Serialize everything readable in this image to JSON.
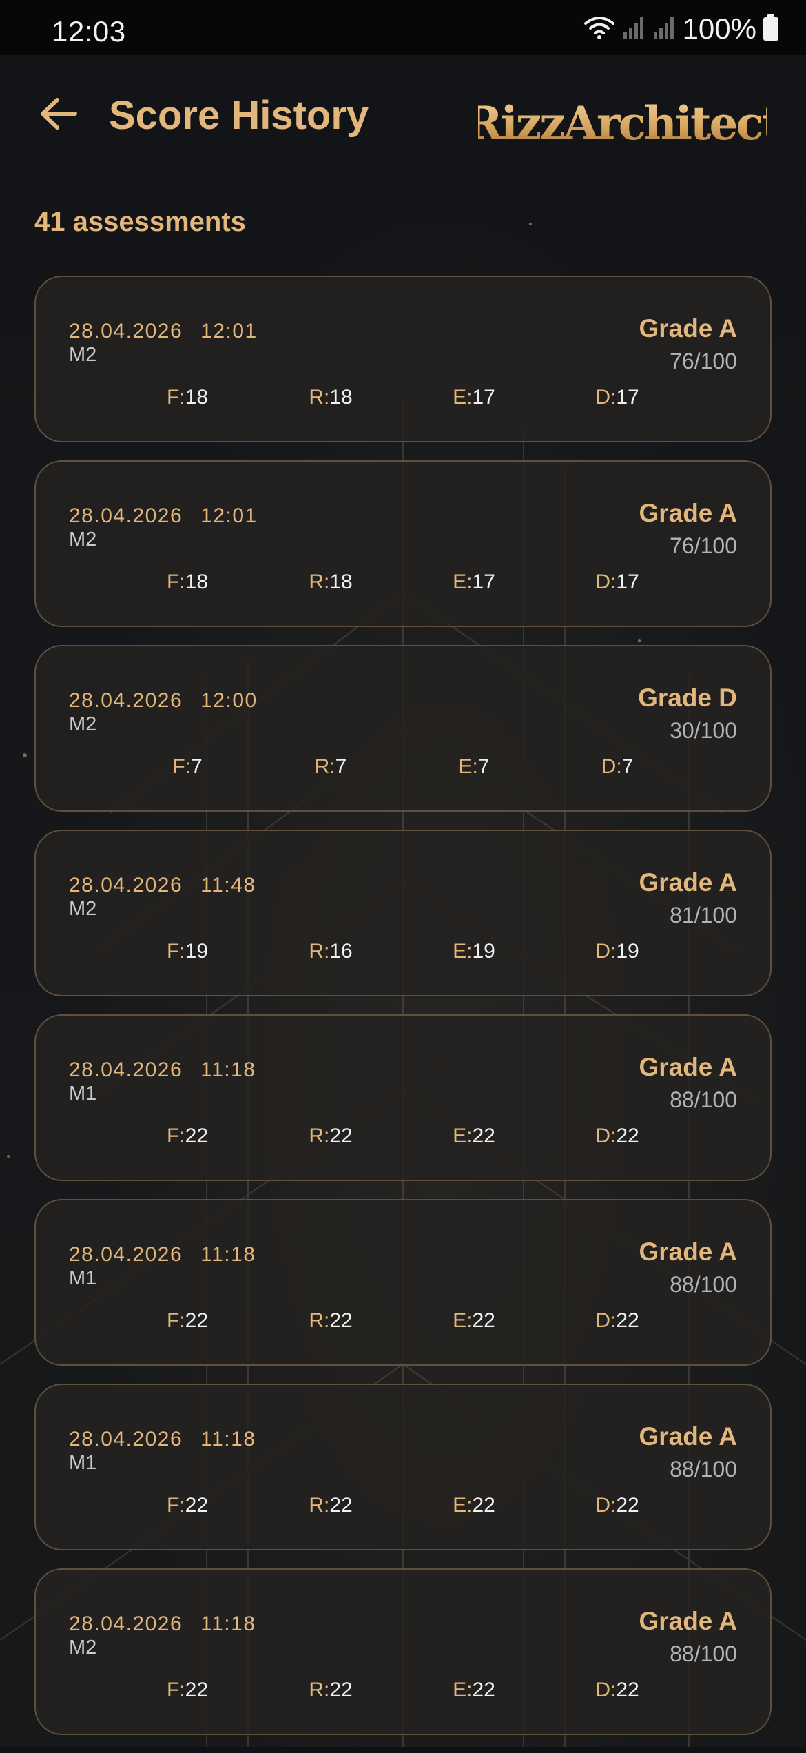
{
  "status_bar": {
    "time": "12:03",
    "battery_percent": "100%"
  },
  "header": {
    "title": "Score History",
    "logo_text": "RizzArchitect"
  },
  "summary": {
    "count_text": "41 assessments"
  },
  "metric_keys": {
    "f": "F:",
    "r": "R:",
    "e": "E:",
    "d": "D:"
  },
  "assessments": [
    {
      "date": "28.04.2026",
      "time": "12:01",
      "model": "M2",
      "grade": "Grade A",
      "score": "76/100",
      "f": "18",
      "r": "18",
      "e": "17",
      "d": "17"
    },
    {
      "date": "28.04.2026",
      "time": "12:01",
      "model": "M2",
      "grade": "Grade A",
      "score": "76/100",
      "f": "18",
      "r": "18",
      "e": "17",
      "d": "17"
    },
    {
      "date": "28.04.2026",
      "time": "12:00",
      "model": "M2",
      "grade": "Grade D",
      "score": "30/100",
      "f": "7",
      "r": "7",
      "e": "7",
      "d": "7"
    },
    {
      "date": "28.04.2026",
      "time": "11:48",
      "model": "M2",
      "grade": "Grade A",
      "score": "81/100",
      "f": "19",
      "r": "16",
      "e": "19",
      "d": "19"
    },
    {
      "date": "28.04.2026",
      "time": "11:18",
      "model": "M1",
      "grade": "Grade A",
      "score": "88/100",
      "f": "22",
      "r": "22",
      "e": "22",
      "d": "22"
    },
    {
      "date": "28.04.2026",
      "time": "11:18",
      "model": "M1",
      "grade": "Grade A",
      "score": "88/100",
      "f": "22",
      "r": "22",
      "e": "22",
      "d": "22"
    },
    {
      "date": "28.04.2026",
      "time": "11:18",
      "model": "M1",
      "grade": "Grade A",
      "score": "88/100",
      "f": "22",
      "r": "22",
      "e": "22",
      "d": "22"
    },
    {
      "date": "28.04.2026",
      "time": "11:18",
      "model": "M2",
      "grade": "Grade A",
      "score": "88/100",
      "f": "22",
      "r": "22",
      "e": "22",
      "d": "22"
    }
  ],
  "colors": {
    "accent_gold": "#e3b77c",
    "background": "#0f1114",
    "card_border": "#5e503c",
    "text_light": "#f2f2f2"
  },
  "icons": {
    "back": "arrow-left-icon",
    "wifi": "wifi-icon",
    "signal": "signal-bars-icon",
    "battery": "battery-icon"
  }
}
